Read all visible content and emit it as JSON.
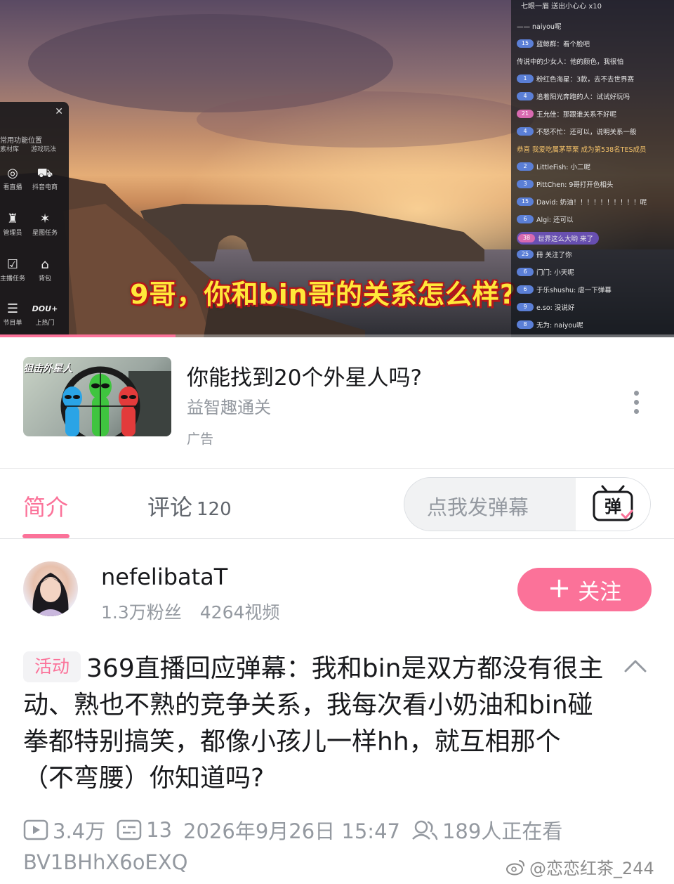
{
  "video": {
    "subtitle": "9哥，你和bin哥的关系怎么样?",
    "progress_fraction": 0.26,
    "panel": {
      "hint": "常用功能位置",
      "sub_left": "素材库",
      "sub_right": "游戏玩法",
      "tools": [
        {
          "label": "看直播",
          "icon": "broadcast-icon",
          "glyph": "◎"
        },
        {
          "label": "抖音电商",
          "icon": "cart-icon",
          "glyph": "⛟"
        },
        {
          "label": "管理员",
          "icon": "admin-icon",
          "glyph": "♜"
        },
        {
          "label": "星图任务",
          "icon": "star-task-icon",
          "glyph": "✶"
        },
        {
          "label": "主播任务",
          "icon": "task-icon",
          "glyph": "☑"
        },
        {
          "label": "背包",
          "icon": "backpack-icon",
          "glyph": "⌂"
        },
        {
          "label": "节目单",
          "icon": "program-icon",
          "glyph": "☰"
        },
        {
          "label": "上热门",
          "icon": "dou-plus-icon",
          "glyph": "DOU+"
        }
      ]
    },
    "chat": {
      "top": "七眼一眉  送出小心心  x10",
      "rows": [
        {
          "level": "",
          "text": "—— naiyou呢"
        },
        {
          "level": "15",
          "text": "蓝鲸群：看个脸吧"
        },
        {
          "level": "",
          "text": "传说中的少女人：他的颜色，我很怕"
        },
        {
          "level": "1",
          "text": "粉红色海星：3款，去不去世界赛"
        },
        {
          "level": "4",
          "text": "追着阳光奔跑的人：试试好玩吗"
        },
        {
          "level": "21",
          "text": "王允佳：那跟谁关系不好呢"
        },
        {
          "level": "4",
          "text": "不怒不忙：还可以，说明关系一般"
        },
        {
          "level": "",
          "text": "恭喜 我爱吃属茅草栗 成为第538名TES成员"
        },
        {
          "level": "2",
          "text": "LittleFish: 小二呢"
        },
        {
          "level": "3",
          "text": "PittChen: 9哥打开色相头"
        },
        {
          "level": "15",
          "text": "David: 奶油！！！！！！！！！！呢"
        },
        {
          "level": "6",
          "text": "Algi: 还可以"
        },
        {
          "level": "38",
          "text": "世界这么大哟 来了"
        },
        {
          "level": "25",
          "text": "冊  关注了你"
        },
        {
          "level": "6",
          "text": "门门: 小天呢"
        },
        {
          "level": "6",
          "text": "于乐shushu: 虐一下弹幕"
        },
        {
          "level": "9",
          "text": "e.so: 没说好"
        },
        {
          "level": "8",
          "text": "无为: naiyou呢"
        }
      ]
    }
  },
  "ad": {
    "thumb_tag": "狙击外星人",
    "title": "你能找到20个外星人吗?",
    "subtitle": "益智趣通关",
    "label": "广告"
  },
  "tabs": {
    "intro": "简介",
    "comments": "评论",
    "comments_count": "120",
    "danmu_placeholder": "点我发弹幕",
    "danmu_icon_text": "弹"
  },
  "uploader": {
    "name": "nefelibataT",
    "fans": "1.3万粉丝",
    "videos": "4264视频",
    "follow_label": "关注"
  },
  "description": {
    "badge": "活动",
    "text": "369直播回应弹幕：我和bin是双方都没有很主动、熟也不熟的竞争关系，我每次看小奶油和bin碰拳都特别搞笑，都像小孩儿一样hh，就互相那个（不弯腰）你知道吗?"
  },
  "meta": {
    "plays": "3.4万",
    "danmu": "13",
    "date": "2026年9月26日 15:47",
    "watching": "189人正在看",
    "bvid": "BV1BHhX6oEXQ"
  },
  "watermark": "@恋恋红茶_244",
  "colors": {
    "accent": "#fb7299",
    "subtitle_yellow": "#ffe83a",
    "muted": "#9499a0"
  }
}
